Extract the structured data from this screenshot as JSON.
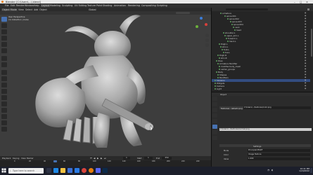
{
  "window": {
    "title": "Blender [C:\\Users\\...\\.blend]"
  },
  "menu": {
    "items": [
      "File",
      "Edit",
      "Render",
      "Window",
      "Help"
    ],
    "workspaces": [
      "Layout",
      "Modeling",
      "Sculpting",
      "UV Editing",
      "Texture Paint",
      "Shading",
      "Animation",
      "Rendering",
      "Compositing",
      "Scripting"
    ],
    "active_workspace": "Layout"
  },
  "viewport": {
    "header": {
      "mode": "Object Mode",
      "view": "View",
      "select": "Select",
      "add": "Add",
      "object": "Object",
      "global": "Global"
    },
    "overlay_text": {
      "line1": "User Perspective",
      "line2": "(1) Collection | Cube"
    }
  },
  "timeline": {
    "menus": [
      "Playback",
      "Keying",
      "View",
      "Marker"
    ],
    "start_label": "Start",
    "start_value": "1",
    "end_label": "End",
    "end_value": "250",
    "current_frame": "1",
    "ticks": [
      "0",
      "20",
      "40",
      "60",
      "80",
      "100",
      "120",
      "140",
      "160",
      "180",
      "200",
      "220",
      "240"
    ]
  },
  "outliner": {
    "rows": [
      {
        "text": "armature",
        "indent": 6
      },
      {
        "text": "spine.001",
        "indent": 9
      },
      {
        "text": "spine.002",
        "indent": 11
      },
      {
        "text": "spine.003",
        "indent": 13
      },
      {
        "text": "spine.004",
        "indent": 14
      },
      {
        "text": "neck",
        "indent": 15
      },
      {
        "text": "head",
        "indent": 16
      },
      {
        "text": "shoulder.L",
        "indent": 8
      },
      {
        "text": "upper_arm.L",
        "indent": 9
      },
      {
        "text": "forearm.L",
        "indent": 10
      },
      {
        "text": "hand.L",
        "indent": 11
      },
      {
        "text": "thigh.L",
        "indent": 5
      },
      {
        "text": "shin.L",
        "indent": 6
      },
      {
        "text": "foot.L",
        "indent": 7
      },
      {
        "text": "toe.L",
        "indent": 8
      },
      {
        "text": "thigh.R",
        "indent": 4
      },
      {
        "text": "shin.R",
        "indent": 5
      },
      {
        "text": "Pose",
        "indent": 3
      },
      {
        "text": "Armature Modifier",
        "indent": 4
      },
      {
        "text": "modifier.body_mesh",
        "indent": 5
      },
      {
        "text": "vertex_groups",
        "indent": 5
      },
      {
        "text": "Body",
        "indent": 3
      },
      {
        "text": "Shapes",
        "indent": 4
      },
      {
        "text": "Modifiers",
        "indent": 4
      },
      {
        "text": "Skeleton",
        "indent": 2
      },
      {
        "text": "Widgets",
        "indent": 2
      },
      {
        "text": "Camera",
        "indent": 2
      },
      {
        "text": "Light",
        "indent": 2
      }
    ],
    "selected_index": 24
  },
  "properties": {
    "header": "Object",
    "path_label": "Textures\\…\\albedo.png",
    "path_value": "C:\\Users\\…\\textures\\color.png",
    "path_value2": "C:\\Users\\…\\textures\\normal.png",
    "section": "Settings",
    "field_a_label": "Mode",
    "field_a_value": "Principled BSDF",
    "field_b_label": "Color",
    "field_b_value": "Image Texture",
    "field_c_label": "Value",
    "field_c_value": "1.000"
  },
  "taskbar": {
    "search_placeholder": "Type here to search",
    "time": "10:41 PM",
    "date": "1/24/2022"
  },
  "colors": {
    "accent": "#4772b3",
    "viewport_bg": "#3d3d3d",
    "selection": "#334d80",
    "taskbar": "#1c1f2b"
  }
}
